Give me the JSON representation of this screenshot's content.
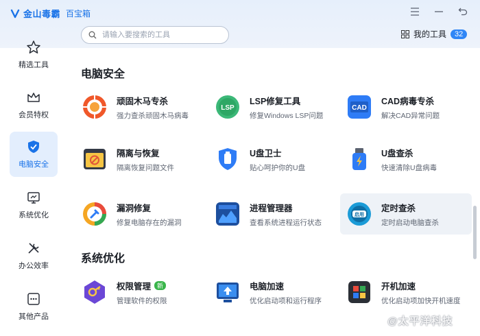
{
  "app": {
    "name": "金山毒霸",
    "subtitle": "百宝箱"
  },
  "search": {
    "placeholder": "请输入要搜索的工具"
  },
  "my_tools": {
    "label": "我的工具",
    "count": "32"
  },
  "sidebar": {
    "items": [
      {
        "label": "精选工具"
      },
      {
        "label": "会员特权"
      },
      {
        "label": "电脑安全"
      },
      {
        "label": "系统优化"
      },
      {
        "label": "办公效率"
      },
      {
        "label": "其他产品"
      }
    ]
  },
  "sections": [
    {
      "title": "电脑安全",
      "tools": [
        {
          "name": "顽固木马专杀",
          "desc": "强力查杀顽固木马病毒"
        },
        {
          "name": "LSP修复工具",
          "desc": "修复Windows LSP问题",
          "icon_text": "LSP"
        },
        {
          "name": "CAD病毒专杀",
          "desc": "解决CAD异常问题",
          "icon_text": "CAD"
        },
        {
          "name": "隔离与恢复",
          "desc": "隔离恢复问题文件"
        },
        {
          "name": "U盘卫士",
          "desc": "贴心呵护你的U盘"
        },
        {
          "name": "U盘查杀",
          "desc": "快速清除U盘病毒"
        },
        {
          "name": "漏洞修复",
          "desc": "修复电脑存在的漏洞"
        },
        {
          "name": "进程管理器",
          "desc": "查看系统进程运行状态"
        },
        {
          "name": "定时查杀",
          "desc": "定时启动电脑查杀",
          "icon_text": "启用"
        }
      ]
    },
    {
      "title": "系统优化",
      "tools": [
        {
          "name": "权限管理",
          "desc": "管理软件的权限",
          "badge": "新"
        },
        {
          "name": "电脑加速",
          "desc": "优化启动项和运行程序"
        },
        {
          "name": "开机加速",
          "desc": "优化启动项加快开机速度"
        }
      ]
    }
  ],
  "watermark": "@太平洋科技",
  "colors": {
    "accent": "#1a73e8",
    "active_bg": "#e3eefd",
    "badge_new": "#39b54a",
    "count_badge": "#2f86f6"
  }
}
